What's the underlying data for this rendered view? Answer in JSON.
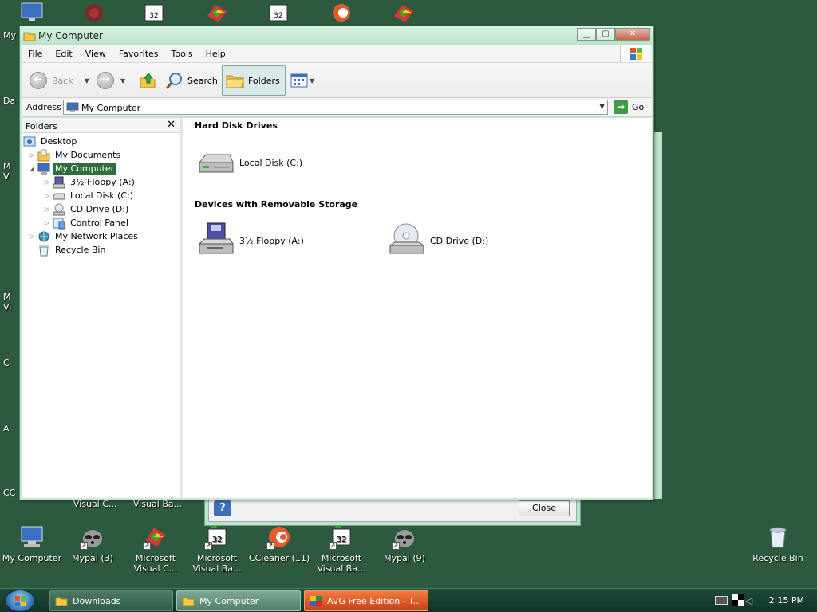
{
  "desktop": {
    "bottom_icons": [
      {
        "name": "desk-my-computer",
        "icon": "computer-icon",
        "label": "My Computer",
        "line2": ""
      },
      {
        "name": "desk-mypal-3",
        "icon": "raccoon-icon",
        "label": "Mypal (3)",
        "line2": ""
      },
      {
        "name": "desk-ms-visual-c",
        "icon": "visual-c-icon",
        "label": "Microsoft",
        "line2": "Visual C..."
      },
      {
        "name": "desk-ms-visual-basic-1",
        "icon": "visual-basic-icon",
        "label": "Microsoft",
        "line2": "Visual Ba..."
      },
      {
        "name": "desk-ccleaner",
        "icon": "ccleaner-icon",
        "label": "CCleaner (11)",
        "line2": ""
      },
      {
        "name": "desk-ms-visual-basic-2",
        "icon": "visual-basic-icon",
        "label": "Microsoft",
        "line2": "Visual Ba..."
      },
      {
        "name": "desk-mypal-9",
        "icon": "raccoon-icon",
        "label": "Mypal (9)",
        "line2": ""
      }
    ],
    "partial_labels": [
      "Visual C...",
      "Visual Ba..."
    ],
    "recycle_bin_label": "Recycle Bin",
    "edge_letters": [
      "My",
      "Da",
      "M",
      "V",
      "M",
      "Vi",
      "C",
      "A",
      "CC"
    ]
  },
  "background_dialog": {
    "close_label": "Close"
  },
  "window": {
    "title": "My Computer",
    "menu": [
      "File",
      "Edit",
      "View",
      "Favorites",
      "Tools",
      "Help"
    ],
    "toolbar": {
      "back_label": "Back",
      "search_label": "Search",
      "folders_label": "Folders"
    },
    "address": {
      "label": "Address",
      "value": "My Computer",
      "go_label": "Go"
    },
    "folders_pane": {
      "title": "Folders",
      "tree": [
        {
          "label": "Desktop",
          "icon": "desktop-icon",
          "level": 0,
          "expander": ""
        },
        {
          "label": "My Documents",
          "icon": "folder-icon",
          "level": 1,
          "expander": "▷"
        },
        {
          "label": "My Computer",
          "icon": "computer-icon",
          "level": 1,
          "expander": "◢",
          "selected": true
        },
        {
          "label": "3½ Floppy (A:)",
          "icon": "floppy-icon",
          "level": 2,
          "expander": "▷"
        },
        {
          "label": "Local Disk (C:)",
          "icon": "hard-disk-icon",
          "level": 2,
          "expander": "▷"
        },
        {
          "label": "CD Drive (D:)",
          "icon": "cd-drive-icon",
          "level": 2,
          "expander": "▷"
        },
        {
          "label": "Control Panel",
          "icon": "control-panel-icon",
          "level": 2,
          "expander": "▷"
        },
        {
          "label": "My Network Places",
          "icon": "network-places-icon",
          "level": 1,
          "expander": "▷"
        },
        {
          "label": "Recycle Bin",
          "icon": "recycle-bin-icon",
          "level": 1,
          "expander": ""
        }
      ]
    },
    "sections": [
      {
        "title": "Hard Disk Drives",
        "items": [
          {
            "label": "Local Disk (C:)",
            "icon": "hard-disk-icon"
          }
        ]
      },
      {
        "title": "Devices with Removable Storage",
        "items": [
          {
            "label": "3½ Floppy (A:)",
            "icon": "floppy-drive-icon"
          },
          {
            "label": "CD Drive (D:)",
            "icon": "cd-drive-icon"
          }
        ]
      }
    ]
  },
  "taskbar": {
    "tasks": [
      {
        "label": "Downloads",
        "icon": "folder-icon"
      },
      {
        "label": "My Computer",
        "icon": "folder-icon",
        "active": true
      },
      {
        "label": "AVG Free Edition - T...",
        "icon": "avg-icon"
      }
    ],
    "clock": "2:15 PM"
  },
  "colors": {
    "desktop": "#2d5a3f",
    "window_frame": "#c9e8d4",
    "selection": "#2f6f3f",
    "taskbar": "#1f4d3a"
  }
}
